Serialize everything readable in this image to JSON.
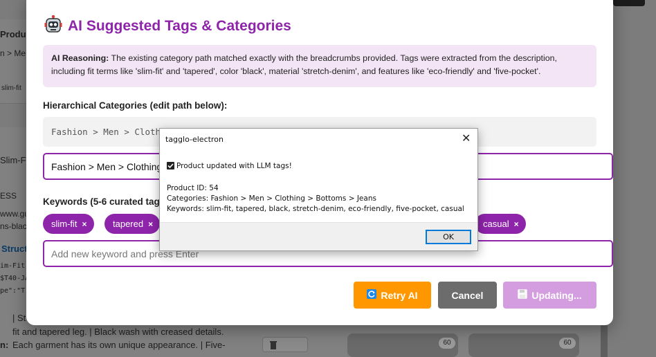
{
  "background": {
    "product_heading": "Produ",
    "crumb": "n > Me",
    "chip": "slim-fit",
    "title_frag": "Slim-Fi",
    "ess": "ESS",
    "url1": "www.gue",
    "url2": "ns-black",
    "struct": "Struct",
    "code1": "im-Fit",
    "code2": "$T40-JA",
    "code3": "pe\":\"T",
    "desc1": "| St",
    "desc2": "fit and tapered leg. | Black wash with creased details.",
    "desc3_label": "n:",
    "desc3": "Each garment has its own unique appearance. | Five-",
    "badge1": "60",
    "badge2": "60"
  },
  "modal": {
    "icon": "robot-icon",
    "title": "AI Suggested Tags & Categories",
    "reasoning_label": "AI Reasoning:",
    "reasoning_text": "The existing category path matched exactly with the breadcrumbs provided. Tags were extracted from the description, including fit terms like 'slim-fit' and 'tapered', color 'black', material 'stretch-denim', and features like 'eco-friendly' and 'five-pocket'.",
    "categories_label": "Hierarchical Categories (edit path below):",
    "path_preview": "Fashion > Men > Clothing > Bottoms > Jeans",
    "path_value": "Fashion > Men > Clothing > Bottoms > Jeans",
    "keywords_label": "Keywords (5-6 curated tags)",
    "tags": [
      "slim-fit",
      "tapered",
      "casual"
    ],
    "tag_remove": "×",
    "keyword_placeholder": "Add new keyword and press Enter",
    "retry_label": "Retry AI",
    "cancel_label": "Cancel",
    "update_label": "Updating...",
    "accent_color": "#8e24aa"
  },
  "dialog": {
    "title": "tagglo-electron",
    "close": "✕",
    "message": "Product updated with LLM tags!",
    "product_id": "Product ID: 54",
    "categories": "Categories: Fashion > Men > Clothing > Bottoms > Jeans",
    "keywords": "Keywords: slim-fit, tapered, black, stretch-denim, eco-friendly, five-pocket, casual",
    "ok_label": "OK"
  }
}
